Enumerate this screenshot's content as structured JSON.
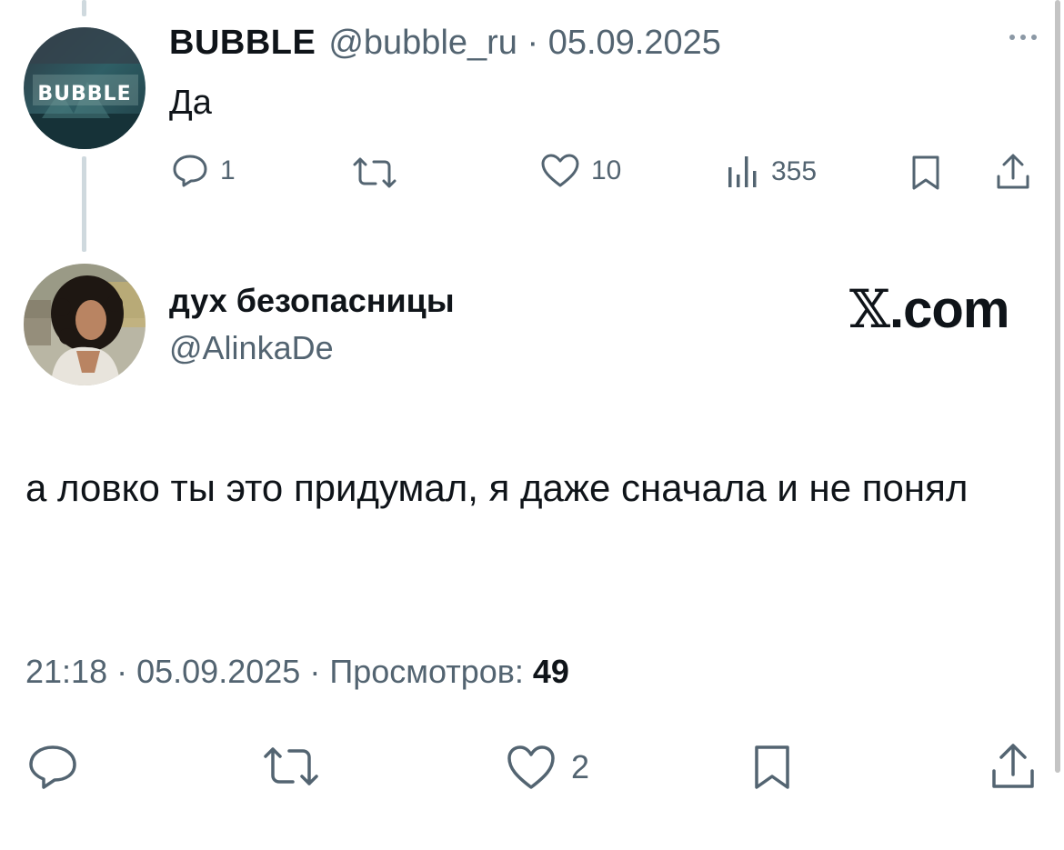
{
  "parent_tweet": {
    "name": "BUBBLE",
    "handle": "@bubble_ru",
    "separator": "·",
    "date": "05.09.2025",
    "text": "Да",
    "avatar_text": "BUBBLE",
    "actions": {
      "replies": "1",
      "likes": "10",
      "views": "355"
    }
  },
  "main_tweet": {
    "name": "дух безопасницы",
    "handle": "@AlinkaDe",
    "brand": {
      "x": "𝕏",
      "suffix": ".com"
    },
    "text": "а ловко ты это придумал, я даже сначала и не понял",
    "meta": {
      "time": "21:18",
      "date": "05.09.2025",
      "views_label": "Просмотров:",
      "views": "49"
    },
    "actions": {
      "likes": "2"
    }
  },
  "icons": {
    "parent": [
      "reply-icon",
      "retweet-icon",
      "like-icon",
      "views-icon",
      "bookmark-icon",
      "share-icon"
    ],
    "main": [
      "reply-icon",
      "retweet-icon",
      "like-icon",
      "bookmark-icon",
      "share-icon"
    ]
  },
  "colors": {
    "text": "#0f1419",
    "secondary": "#536471",
    "thread_line": "#cfd9de",
    "background": "#ffffff"
  }
}
